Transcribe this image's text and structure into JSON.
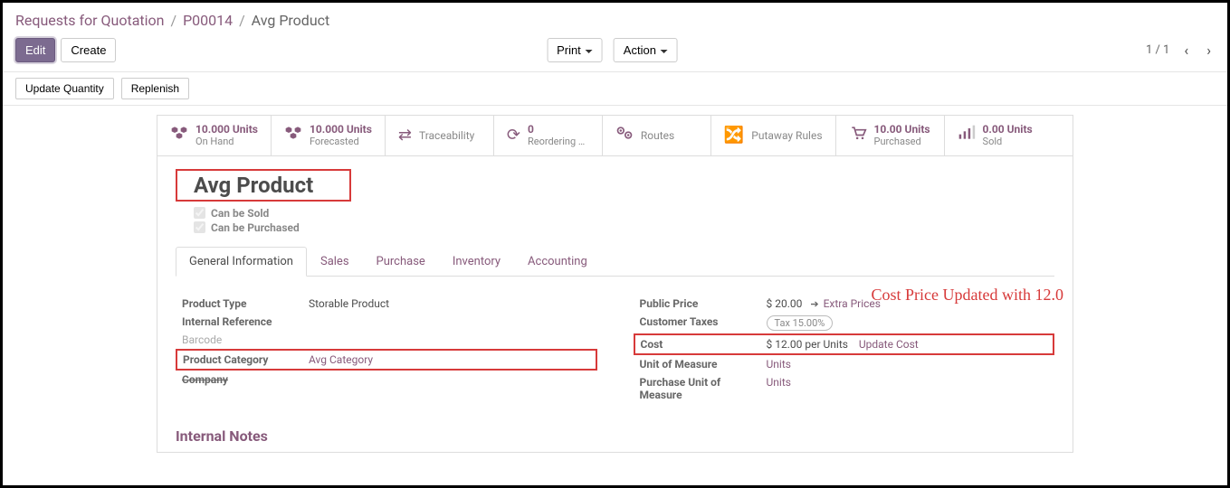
{
  "breadcrumb": {
    "root": "Requests for Quotation",
    "order": "P00014",
    "current": "Avg Product"
  },
  "toolbar": {
    "edit": "Edit",
    "create": "Create",
    "print": "Print",
    "action": "Action",
    "pager": "1 / 1"
  },
  "subbar": {
    "update_qty": "Update Quantity",
    "replenish": "Replenish"
  },
  "stats": {
    "on_hand": {
      "value": "10.000 Units",
      "label": "On Hand"
    },
    "forecasted": {
      "value": "10.000 Units",
      "label": "Forecasted"
    },
    "traceability": {
      "label": "Traceability"
    },
    "reordering": {
      "value": "0",
      "label": "Reordering …"
    },
    "routes": {
      "label": "Routes"
    },
    "putaway": {
      "label": "Putaway Rules"
    },
    "purchased": {
      "value": "10.00 Units",
      "label": "Purchased"
    },
    "sold": {
      "value": "0.00 Units",
      "label": "Sold"
    }
  },
  "product": {
    "title": "Avg Product",
    "can_be_sold": "Can be Sold",
    "can_be_purchased": "Can be Purchased"
  },
  "tabs": {
    "general": "General Information",
    "sales": "Sales",
    "purchase": "Purchase",
    "inventory": "Inventory",
    "accounting": "Accounting"
  },
  "annotation": "Cost Price Updated with 12.0",
  "left": {
    "product_type_lbl": "Product Type",
    "product_type_val": "Storable Product",
    "internal_ref_lbl": "Internal Reference",
    "barcode_lbl": "Barcode",
    "category_lbl": "Product Category",
    "category_val": "Avg Category",
    "company_lbl": "Company"
  },
  "right": {
    "public_price_lbl": "Public Price",
    "public_price_val": "$ 20.00",
    "extra_prices": "Extra Prices",
    "cust_tax_lbl": "Customer Taxes",
    "cust_tax_val": "Tax 15.00%",
    "cost_lbl": "Cost",
    "cost_val": "$ 12.00",
    "cost_per": "per Units",
    "update_cost": "Update Cost",
    "uom_lbl": "Unit of Measure",
    "uom_val": "Units",
    "puom_lbl": "Purchase Unit of Measure",
    "puom_val": "Units"
  },
  "internal_notes": "Internal Notes"
}
